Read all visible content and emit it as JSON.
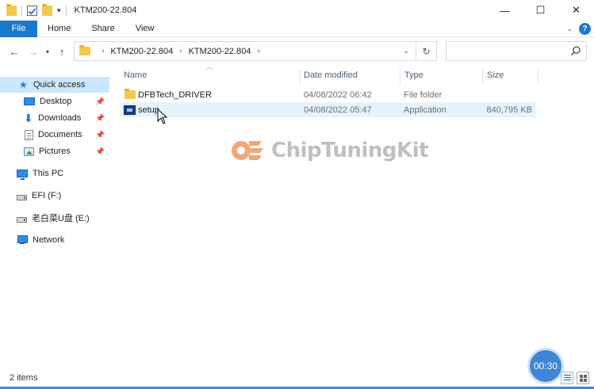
{
  "window": {
    "title": "KTM200-22.804",
    "minimize": "—",
    "maximize": "☐",
    "close": "✕"
  },
  "ribbon": {
    "tabs": [
      "File",
      "Home",
      "Share",
      "View"
    ],
    "expand_icon": "chevron-down-icon",
    "help": "?"
  },
  "address": {
    "breadcrumbs": [
      "KTM200-22.804",
      "KTM200-22.804"
    ],
    "search_placeholder": ""
  },
  "navpane": {
    "items": [
      {
        "label": "Quick access",
        "icon": "star-icon",
        "selected": true
      },
      {
        "label": "Desktop",
        "icon": "desktop-icon",
        "pinned": true
      },
      {
        "label": "Downloads",
        "icon": "downloads-icon",
        "pinned": true
      },
      {
        "label": "Documents",
        "icon": "documents-icon",
        "pinned": true
      },
      {
        "label": "Pictures",
        "icon": "pictures-icon",
        "pinned": true
      },
      {
        "label": "This PC",
        "icon": "this-pc-icon"
      },
      {
        "label": "EFI (F:)",
        "icon": "drive-icon"
      },
      {
        "label": "老白菜U盘 (E:)",
        "icon": "drive-icon"
      },
      {
        "label": "Network",
        "icon": "network-icon"
      }
    ]
  },
  "columns": {
    "name": "Name",
    "date": "Date modified",
    "type": "Type",
    "size": "Size"
  },
  "files": [
    {
      "name": "DFBTech_DRIVER",
      "date": "04/08/2022 06:42",
      "type": "File folder",
      "size": "",
      "icon": "folder-icon"
    },
    {
      "name": "setup",
      "date": "04/08/2022 05:47",
      "type": "Application",
      "size": "840,795 KB",
      "icon": "application-icon"
    }
  ],
  "watermark": {
    "text": "ChipTuningKit",
    "color": "#f08a4b"
  },
  "status": {
    "items": "2 items"
  },
  "timer": {
    "text": "00:30"
  },
  "colors": {
    "accent": "#1979ca",
    "selection": "#cce8ff",
    "row_selection": "#e5f3ff"
  }
}
